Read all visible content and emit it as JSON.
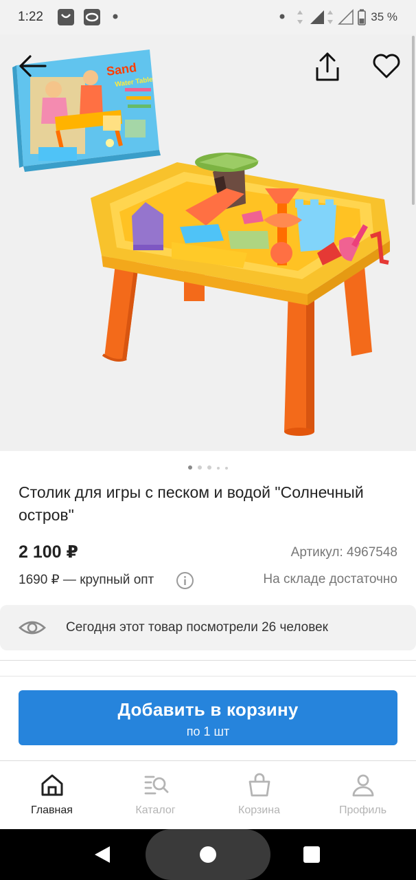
{
  "status_bar": {
    "time": "1:22",
    "battery": "35 %"
  },
  "product": {
    "title": "Столик для игры с песком и водой \"Солнечный остров\"",
    "price": "2 100 ₽",
    "sku": "Артикул: 4967548",
    "wholesale_price": "1690 ₽ — крупный опт",
    "stock": "На складе достаточно",
    "views": "Сегодня этот товар посмотрели 26 человек",
    "image_count": 5,
    "active_image": 1,
    "box_text": "Sand Water Table",
    "box_logo_text": "Sand"
  },
  "actions": {
    "add_to_cart": "Добавить в корзину",
    "quantity": "по 1 шт"
  },
  "nav": {
    "items": [
      {
        "label": "Главная",
        "icon": "home-icon",
        "active": true
      },
      {
        "label": "Каталог",
        "icon": "catalog-search-icon",
        "active": false
      },
      {
        "label": "Корзина",
        "icon": "basket-icon",
        "active": false
      },
      {
        "label": "Профиль",
        "icon": "profile-icon",
        "active": false
      }
    ]
  },
  "colors": {
    "accent": "#2684dc",
    "nav_inactive": "#b4b4b4",
    "table_yellow": "#f8c22c",
    "table_orange": "#f36a1a"
  }
}
